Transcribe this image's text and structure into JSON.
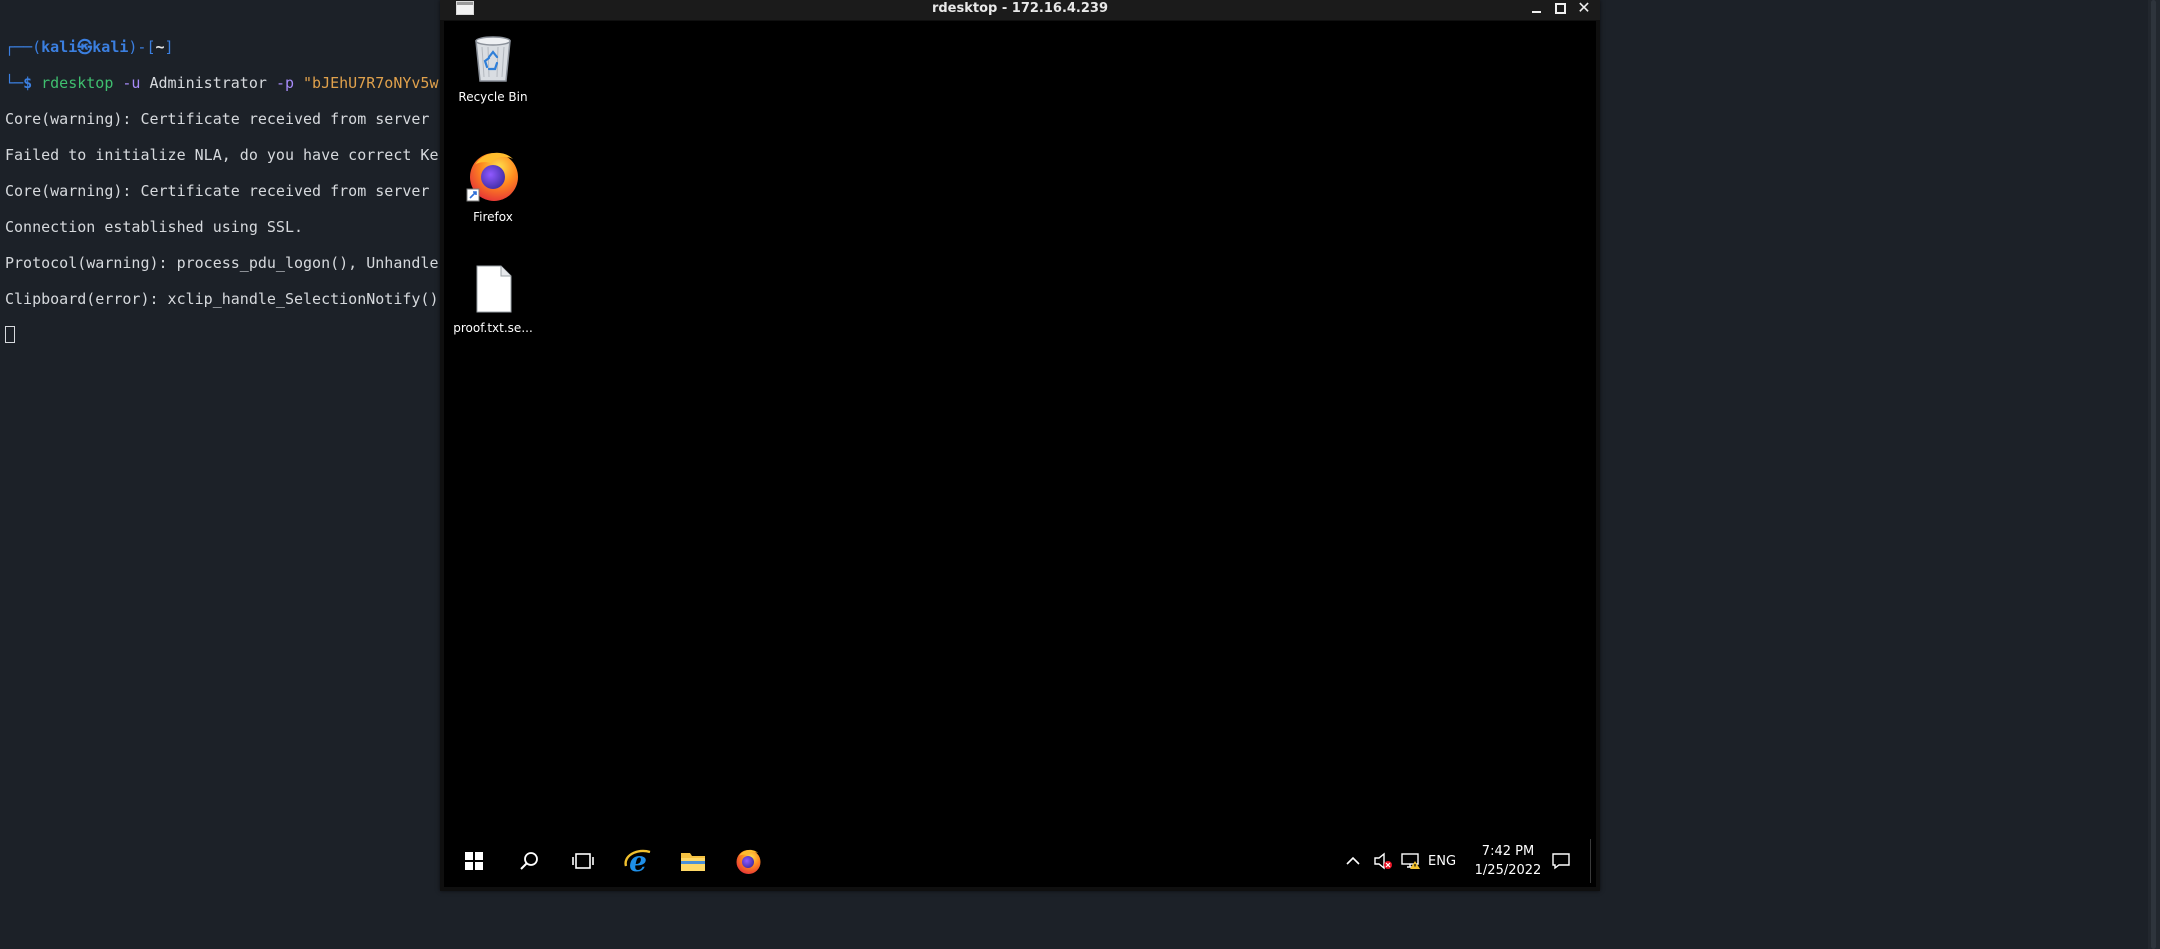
{
  "terminal": {
    "prompt": {
      "open": "┌──(",
      "user": "kali",
      "at": "㉿",
      "host": "kali",
      "mid": ")-[",
      "dir": "~",
      "close": "]",
      "line2": "└─",
      "dollar": "$ "
    },
    "command": {
      "bin": "rdesktop",
      "flag_u": "-u",
      "user": "Administrator",
      "flag_p": "-p",
      "password": "\"bJEhU7R7oNYv5w"
    },
    "output": [
      "Core(warning): Certificate received from server",
      "Failed to initialize NLA, do you have correct Ke",
      "Core(warning): Certificate received from server",
      "Connection established using SSL.",
      "Protocol(warning): process_pdu_logon(), Unhandle",
      "Clipboard(error): xclip_handle_SelectionNotify()"
    ]
  },
  "rdp_window": {
    "title": "rdesktop - 172.16.4.239"
  },
  "desktop": {
    "icons": [
      {
        "label": "Recycle Bin",
        "icon": "recycle-bin-icon"
      },
      {
        "label": "Firefox",
        "icon": "firefox-icon"
      },
      {
        "label": "proof.txt.se...",
        "icon": "text-file-icon"
      }
    ]
  },
  "taskbar": {
    "items": [
      "start-icon",
      "search-icon",
      "task-view-icon",
      "internet-explorer-icon",
      "file-explorer-icon",
      "firefox-icon"
    ],
    "tray": {
      "language": "ENG",
      "time": "7:42 PM",
      "date": "1/25/2022"
    }
  },
  "colors": {
    "terminal_bg": "#1c2128",
    "prompt_blue": "#3b7fe0",
    "cmd_green": "#3fbf6f",
    "flag_purple": "#a78bfa",
    "string_orange": "#e0a14c",
    "desktop_bg": "#000000"
  }
}
